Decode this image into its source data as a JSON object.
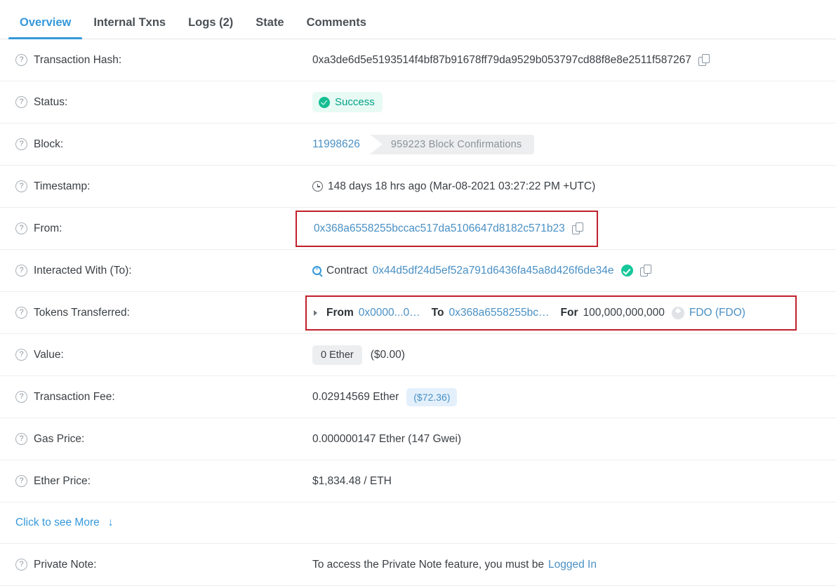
{
  "tabs": [
    {
      "label": "Overview",
      "active": true
    },
    {
      "label": "Internal Txns",
      "active": false
    },
    {
      "label": "Logs (2)",
      "active": false
    },
    {
      "label": "State",
      "active": false
    },
    {
      "label": "Comments",
      "active": false
    }
  ],
  "rows": {
    "txhash": {
      "label": "Transaction Hash:",
      "value": "0xa3de6d5e5193514f4bf87b91678ff79da9529b053797cd88f8e8e2511f587267"
    },
    "status": {
      "label": "Status:",
      "value": "Success"
    },
    "block": {
      "label": "Block:",
      "number": "11998626",
      "confirmations": "959223 Block Confirmations"
    },
    "timestamp": {
      "label": "Timestamp:",
      "value": "148 days 18 hrs ago (Mar-08-2021 03:27:22 PM +UTC)"
    },
    "from": {
      "label": "From:",
      "address": "0x368a6558255bccac517da5106647d8182c571b23"
    },
    "to": {
      "label": "Interacted With (To):",
      "prefix": "Contract",
      "address": "0x44d5df24d5ef52a791d6436fa45a8d426f6de34e"
    },
    "tokens": {
      "label": "Tokens Transferred:",
      "from_kw": "From",
      "from_addr": "0x0000...0…",
      "to_kw": "To",
      "to_addr": "0x368a6558255bc…",
      "for_kw": "For",
      "amount": "100,000,000,000",
      "token": "FDO (FDO)"
    },
    "value": {
      "label": "Value:",
      "amount": "0 Ether",
      "fiat": "($0.00)"
    },
    "txfee": {
      "label": "Transaction Fee:",
      "amount": "0.02914569 Ether",
      "fiat": "($72.36)"
    },
    "gasprice": {
      "label": "Gas Price:",
      "value": "0.000000147 Ether (147 Gwei)"
    },
    "etherprice": {
      "label": "Ether Price:",
      "value": "$1,834.48 / ETH"
    },
    "more": {
      "label": "Click to see More",
      "arrow": "↓"
    },
    "privatenote": {
      "label": "Private Note:",
      "text": "To access the Private Note feature, you must be",
      "link": "Logged In"
    }
  },
  "icons": {
    "help": "?",
    "copy": "copy-icon",
    "clock": "clock-icon",
    "magnifier": "magnifier-icon",
    "verified": "verified-check-icon",
    "token": "fdo-token-icon"
  },
  "colors": {
    "accent_blue": "#3498db",
    "link_blue": "#4a90c4",
    "success_green": "#00a186",
    "highlight_red": "#c0202b"
  }
}
